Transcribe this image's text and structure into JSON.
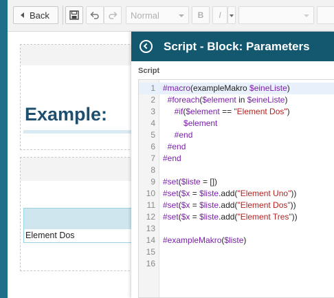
{
  "toolbar": {
    "back_label": "Back",
    "format_value": "Normal",
    "bold_label": "B",
    "italic_label": "I"
  },
  "content": {
    "title": "Example: ",
    "table_cell": "Element Dos"
  },
  "panel": {
    "title": "Script - Block: Parameters",
    "script_label": "Script"
  },
  "code_lines": [
    [
      {
        "t": "k",
        "v": "#macro"
      },
      {
        "t": "t",
        "v": "(exampleMakro "
      },
      {
        "t": "k",
        "v": "$eineListe"
      },
      {
        "t": "t",
        "v": ")"
      }
    ],
    [
      {
        "t": "t",
        "v": "  "
      },
      {
        "t": "k",
        "v": "#foreach"
      },
      {
        "t": "t",
        "v": "("
      },
      {
        "t": "k",
        "v": "$element"
      },
      {
        "t": "t",
        "v": " in "
      },
      {
        "t": "k",
        "v": "$eineListe"
      },
      {
        "t": "t",
        "v": ")"
      }
    ],
    [
      {
        "t": "t",
        "v": "     "
      },
      {
        "t": "k",
        "v": "#if"
      },
      {
        "t": "t",
        "v": "("
      },
      {
        "t": "k",
        "v": "$element"
      },
      {
        "t": "t",
        "v": " == "
      },
      {
        "t": "s",
        "v": "\"Element Dos\""
      },
      {
        "t": "t",
        "v": ")"
      }
    ],
    [
      {
        "t": "t",
        "v": "         "
      },
      {
        "t": "k",
        "v": "$element"
      }
    ],
    [
      {
        "t": "t",
        "v": "     "
      },
      {
        "t": "k",
        "v": "#end"
      }
    ],
    [
      {
        "t": "t",
        "v": "  "
      },
      {
        "t": "k",
        "v": "#end"
      }
    ],
    [
      {
        "t": "k",
        "v": "#end"
      }
    ],
    [],
    [
      {
        "t": "k",
        "v": "#set"
      },
      {
        "t": "t",
        "v": "("
      },
      {
        "t": "k",
        "v": "$liste"
      },
      {
        "t": "t",
        "v": " = [])"
      }
    ],
    [
      {
        "t": "k",
        "v": "#set"
      },
      {
        "t": "t",
        "v": "("
      },
      {
        "t": "k",
        "v": "$x"
      },
      {
        "t": "t",
        "v": " = "
      },
      {
        "t": "k",
        "v": "$liste"
      },
      {
        "t": "t",
        "v": ".add("
      },
      {
        "t": "s",
        "v": "\"Element Uno\""
      },
      {
        "t": "t",
        "v": "))"
      }
    ],
    [
      {
        "t": "k",
        "v": "#set"
      },
      {
        "t": "t",
        "v": "("
      },
      {
        "t": "k",
        "v": "$x"
      },
      {
        "t": "t",
        "v": " = "
      },
      {
        "t": "k",
        "v": "$liste"
      },
      {
        "t": "t",
        "v": ".add("
      },
      {
        "t": "s",
        "v": "\"Element Dos\""
      },
      {
        "t": "t",
        "v": "))"
      }
    ],
    [
      {
        "t": "k",
        "v": "#set"
      },
      {
        "t": "t",
        "v": "("
      },
      {
        "t": "k",
        "v": "$x"
      },
      {
        "t": "t",
        "v": " = "
      },
      {
        "t": "k",
        "v": "$liste"
      },
      {
        "t": "t",
        "v": ".add("
      },
      {
        "t": "s",
        "v": "\"Element Tres\""
      },
      {
        "t": "t",
        "v": "))"
      }
    ],
    [],
    [
      {
        "t": "k",
        "v": "#exampleMakro"
      },
      {
        "t": "t",
        "v": "("
      },
      {
        "t": "k",
        "v": "$liste"
      },
      {
        "t": "t",
        "v": ")"
      }
    ],
    [],
    []
  ],
  "active_line": 1,
  "colors": {
    "header": "#14586f",
    "keyword": "#7a1fa8",
    "string": "#b22222",
    "title": "#1f4f6e"
  },
  "icons": [
    "chevron-left-icon",
    "save-icon",
    "undo-icon",
    "redo-icon",
    "circle-arrow-left-icon"
  ]
}
